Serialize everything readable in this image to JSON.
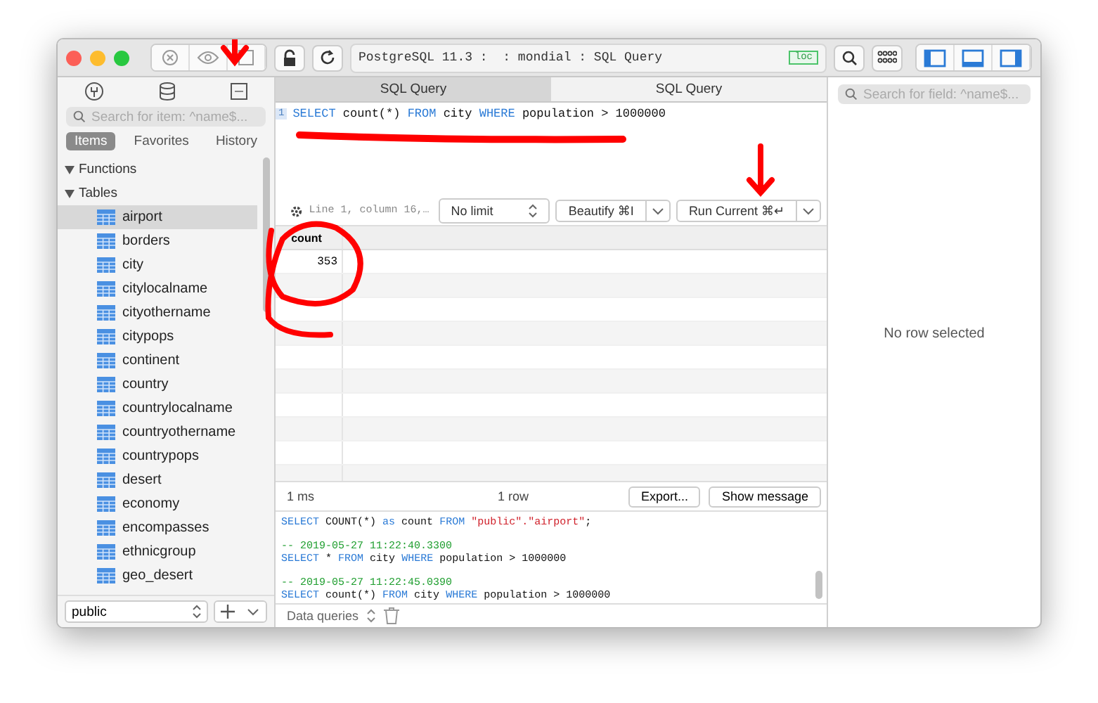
{
  "toolbar": {
    "address": "PostgreSQL 11.3 :  : mondial : SQL Query",
    "badge": "loc",
    "panels": [
      {
        "on": true
      },
      {
        "on": true
      },
      {
        "on": true
      }
    ]
  },
  "sidebar": {
    "search": {
      "placeholder": "Search for item: ^name$..."
    },
    "tabs": [
      {
        "label": "Items",
        "selected": true
      },
      {
        "label": "Favorites",
        "selected": false
      },
      {
        "label": "History",
        "selected": false
      }
    ],
    "tree": [
      {
        "label": "Functions",
        "expanded": true
      },
      {
        "label": "Tables",
        "expanded": true,
        "children": [
          {
            "label": "airport",
            "selected": true
          },
          {
            "label": "borders",
            "selected": false
          },
          {
            "label": "city",
            "selected": false
          },
          {
            "label": "citylocalname",
            "selected": false
          },
          {
            "label": "cityothername",
            "selected": false
          },
          {
            "label": "citypops",
            "selected": false
          },
          {
            "label": "continent",
            "selected": false
          },
          {
            "label": "country",
            "selected": false
          },
          {
            "label": "countrylocalname",
            "selected": false
          },
          {
            "label": "countryothername",
            "selected": false
          },
          {
            "label": "countrypops",
            "selected": false
          },
          {
            "label": "desert",
            "selected": false
          },
          {
            "label": "economy",
            "selected": false
          },
          {
            "label": "encompasses",
            "selected": false
          },
          {
            "label": "ethnicgroup",
            "selected": false
          },
          {
            "label": "geo_desert",
            "selected": false
          }
        ]
      }
    ],
    "schema": "public"
  },
  "editor": {
    "tabs": [
      {
        "label": "SQL Query",
        "selected": false
      },
      {
        "label": "SQL Query",
        "selected": true
      }
    ],
    "line_number": "1",
    "query": [
      {
        "kind": "keyword",
        "text": "SELECT"
      },
      {
        "kind": "plain",
        "text": " count(*) "
      },
      {
        "kind": "keyword",
        "text": "FROM"
      },
      {
        "kind": "plain",
        "text": " city "
      },
      {
        "kind": "keyword",
        "text": "WHERE"
      },
      {
        "kind": "plain",
        "text": " population > 1000000"
      }
    ],
    "position": "Line 1, column 16,…",
    "limit": "No limit",
    "beautify": "Beautify ⌘I",
    "run": "Run Current ⌘↵"
  },
  "results": {
    "columns": [
      "count"
    ],
    "rows": [
      [
        "353"
      ]
    ],
    "time": "1 ms",
    "row_count": "1 row",
    "export": "Export...",
    "show_message": "Show message"
  },
  "log": [
    {
      "tokens": [
        {
          "kind": "keyword",
          "text": "SELECT"
        },
        {
          "kind": "plain",
          "text": " COUNT(*) "
        },
        {
          "kind": "keyword",
          "text": "as"
        },
        {
          "kind": "plain",
          "text": " count "
        },
        {
          "kind": "keyword",
          "text": "FROM"
        },
        {
          "kind": "string",
          "text": " \"public\".\"airport\""
        },
        {
          "kind": "plain",
          "text": ";"
        }
      ]
    },
    {
      "timestamp": "-- 2019-05-27 11:22:40.3300",
      "tokens": [
        {
          "kind": "keyword",
          "text": "SELECT"
        },
        {
          "kind": "plain",
          "text": " * "
        },
        {
          "kind": "keyword",
          "text": "FROM"
        },
        {
          "kind": "plain",
          "text": " city "
        },
        {
          "kind": "keyword",
          "text": "WHERE"
        },
        {
          "kind": "plain",
          "text": " population > 1000000"
        }
      ]
    },
    {
      "timestamp": "-- 2019-05-27 11:22:45.0390",
      "tokens": [
        {
          "kind": "keyword",
          "text": "SELECT"
        },
        {
          "kind": "plain",
          "text": " count(*) "
        },
        {
          "kind": "keyword",
          "text": "FROM"
        },
        {
          "kind": "plain",
          "text": " city "
        },
        {
          "kind": "keyword",
          "text": "WHERE"
        },
        {
          "kind": "plain",
          "text": " population > 1000000"
        }
      ]
    }
  ],
  "log_filter": "Data queries",
  "detail": {
    "search": {
      "placeholder": "Search for field: ^name$..."
    },
    "empty": "No row selected"
  }
}
